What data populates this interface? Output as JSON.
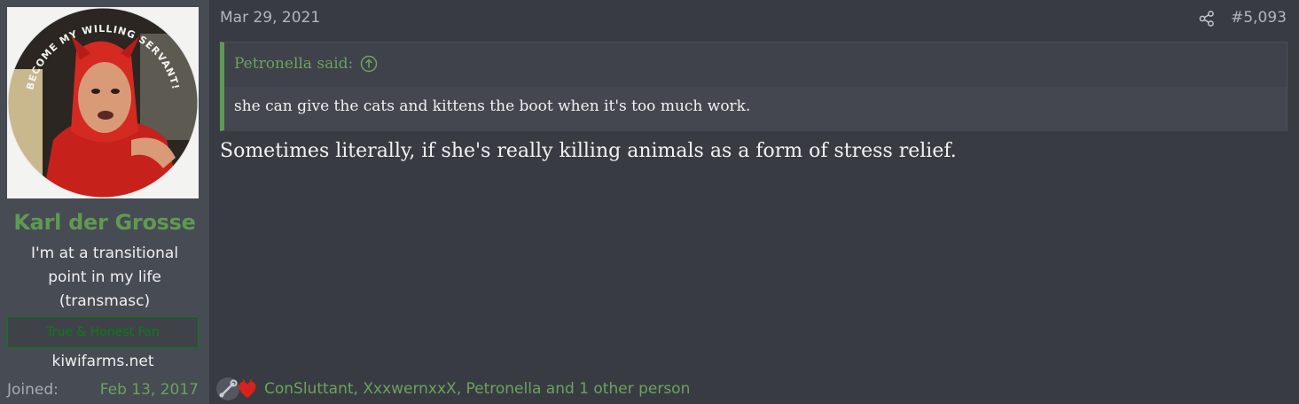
{
  "user": {
    "avatar_caption": "BECOME MY WILLING SERVANT!",
    "name": "Karl der Grosse",
    "title": "I'm at a transitional point in my life (transmasc)",
    "banner": "True & Honest Fan",
    "site": "kiwifarms.net",
    "joined_label": "Joined:",
    "joined_value": "Feb 13, 2017"
  },
  "post": {
    "date": "Mar 29, 2021",
    "number": "#5,093",
    "share_icon": "share-icon",
    "quote": {
      "author": "Petronella said:",
      "jump_icon": "arrow-up-circle-icon",
      "text": "she can give the cats and kittens the boot when it's too much work."
    },
    "message": "Sometimes literally, if she's really killing animals as a form of stress relief.",
    "reactions": {
      "icons": [
        "wrench-icon",
        "heart-icon"
      ],
      "text": "ConSluttant, XxxwernxxX, Petronella and 1 other person"
    }
  },
  "colors": {
    "page_bg": "#393b43",
    "user_cell_bg": "#474b53",
    "accent_green": "#5e9a52",
    "banner_green": "#0c7a18",
    "text": "#f2f2f2",
    "muted": "#b3b6bb"
  }
}
